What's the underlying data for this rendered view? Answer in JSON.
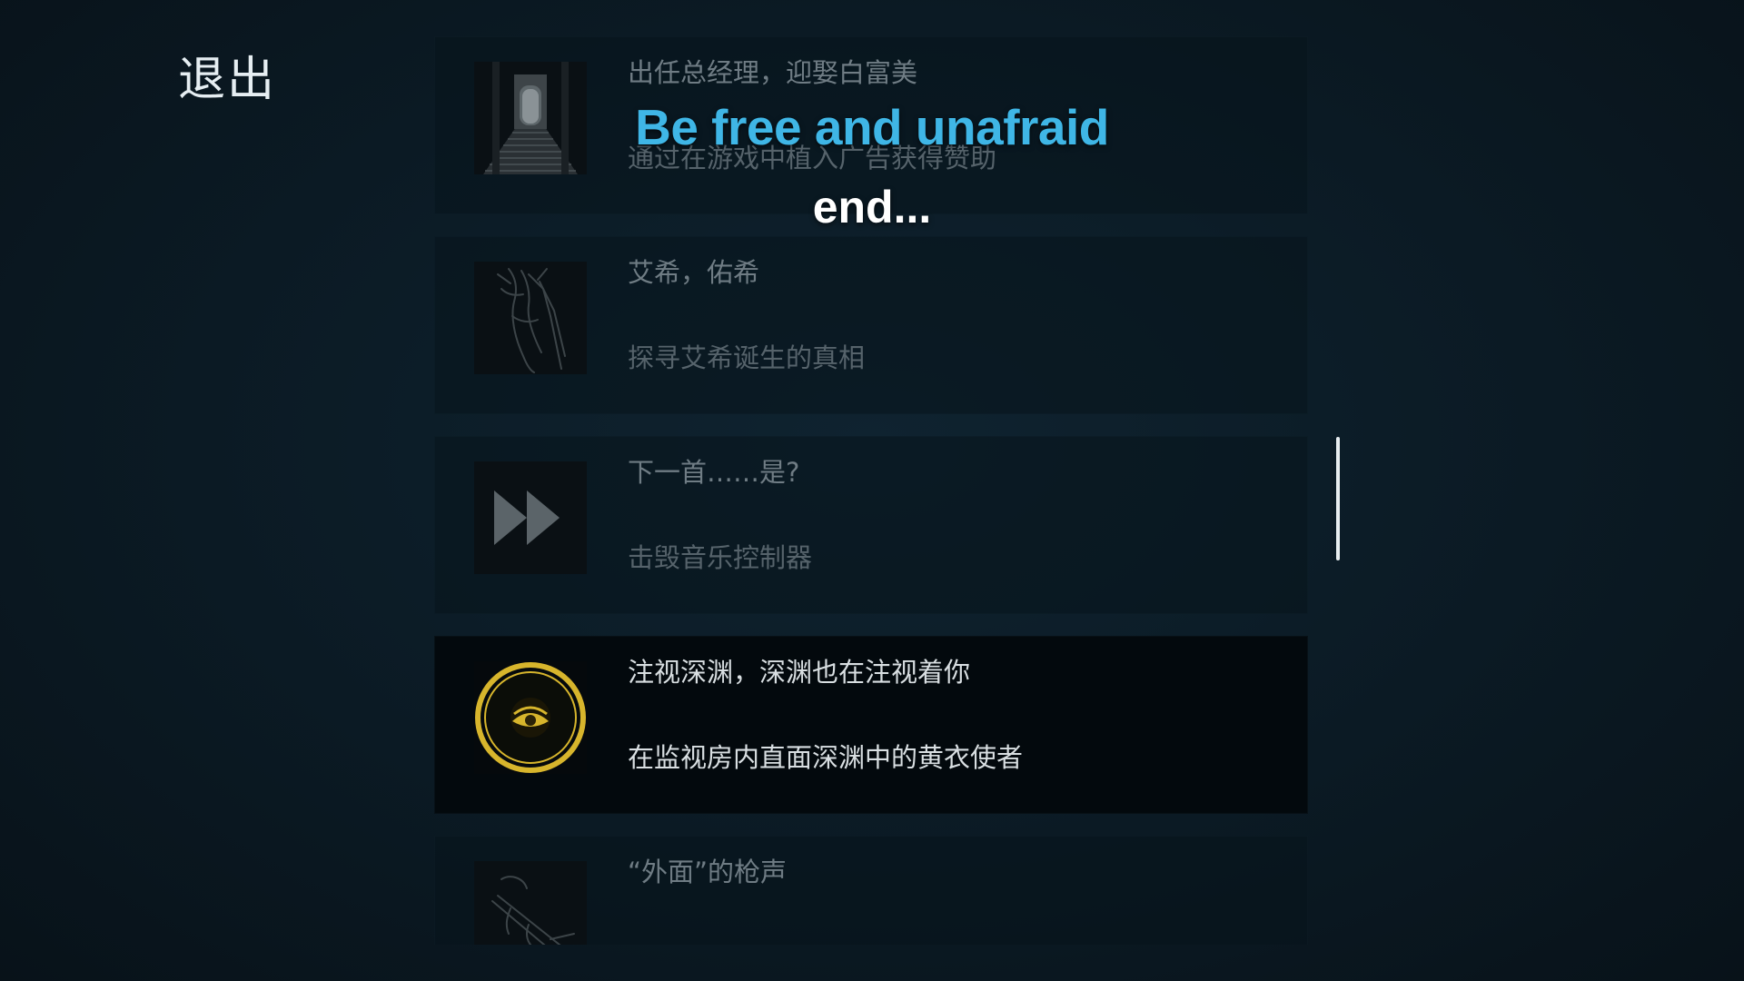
{
  "exit_label": "退出",
  "achievements": [
    {
      "title": "出任总经理，迎娶白富美",
      "description": "通过在游戏中植入广告获得赞助",
      "icon": "corridor-door-icon",
      "active": false
    },
    {
      "title": "艾希，佑希",
      "description": "探寻艾希诞生的真相",
      "icon": "sketch-figure-icon",
      "active": false
    },
    {
      "title": "下一首……是?",
      "description": "击毁音乐控制器",
      "icon": "fast-forward-icon",
      "active": false
    },
    {
      "title": "注视深渊，深渊也在注视着你",
      "description": "在监视房内直面深渊中的黄衣使者",
      "icon": "yellow-eye-emblem-icon",
      "active": true
    },
    {
      "title": "“外面”的枪声",
      "description": "",
      "icon": "rifle-sketch-icon",
      "active": false
    }
  ],
  "subtitle": {
    "main": "Be free and unafraid",
    "sub": "end..."
  },
  "colors": {
    "background": "#0b1a24",
    "subtitle_main": "#3fb6e6",
    "emblem_gold": "#d7b52c"
  }
}
